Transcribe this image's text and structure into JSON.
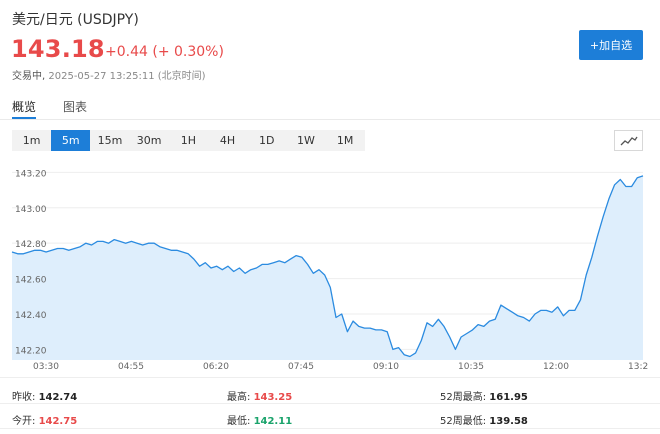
{
  "header": {
    "title": "美元/日元 (USDJPY)",
    "price": "143.18",
    "change": "+0.44 (+ 0.30%)",
    "status_label": "交易中,",
    "timestamp": "2025-05-27 13:25:11 (北京时间)",
    "watch_button": "+加自选"
  },
  "tabs": [
    {
      "label": "概览",
      "active": true
    },
    {
      "label": "图表",
      "active": false
    }
  ],
  "ranges": [
    {
      "label": "1m",
      "active": false
    },
    {
      "label": "5m",
      "active": true
    },
    {
      "label": "15m",
      "active": false
    },
    {
      "label": "30m",
      "active": false
    },
    {
      "label": "1H",
      "active": false
    },
    {
      "label": "4H",
      "active": false
    },
    {
      "label": "1D",
      "active": false
    },
    {
      "label": "1W",
      "active": false
    },
    {
      "label": "1M",
      "active": false
    }
  ],
  "chart_type_icon": "line-chart-icon",
  "colors": {
    "accent": "#1d7ed8",
    "up": "#e84a4a",
    "down": "#1aa36b",
    "line": "#2b8be0",
    "fill": "#deeefc"
  },
  "chart_data": {
    "type": "area",
    "xlabel": "",
    "ylabel": "",
    "ylim": [
      142.14,
      143.27
    ],
    "y_ticks": [
      "143.20",
      "143.00",
      "142.80",
      "142.60",
      "142.40",
      "142.20"
    ],
    "x_ticks": [
      "03:30",
      "04:55",
      "06:20",
      "07:45",
      "09:10",
      "10:35",
      "12:00",
      "13:2"
    ],
    "series": [
      {
        "values": [
          142.75,
          142.74,
          142.74,
          142.75,
          142.76,
          142.76,
          142.75,
          142.76,
          142.77,
          142.77,
          142.76,
          142.77,
          142.78,
          142.8,
          142.79,
          142.81,
          142.81,
          142.8,
          142.82,
          142.81,
          142.8,
          142.81,
          142.8,
          142.79,
          142.8,
          142.8,
          142.78,
          142.77,
          142.76,
          142.76,
          142.75,
          142.74,
          142.71,
          142.67,
          142.69,
          142.66,
          142.67,
          142.65,
          142.67,
          142.64,
          142.66,
          142.63,
          142.65,
          142.66,
          142.68,
          142.68,
          142.69,
          142.7,
          142.69,
          142.71,
          142.73,
          142.72,
          142.68,
          142.63,
          142.65,
          142.62,
          142.55,
          142.38,
          142.4,
          142.3,
          142.36,
          142.33,
          142.32,
          142.32,
          142.31,
          142.31,
          142.3,
          142.2,
          142.21,
          142.17,
          142.16,
          142.18,
          142.25,
          142.35,
          142.33,
          142.37,
          142.33,
          142.27,
          142.2,
          142.27,
          142.29,
          142.31,
          142.34,
          142.33,
          142.36,
          142.37,
          142.45,
          142.43,
          142.41,
          142.39,
          142.38,
          142.36,
          142.4,
          142.42,
          142.42,
          142.41,
          142.44,
          142.39,
          142.42,
          142.42,
          142.48,
          142.62,
          142.72,
          142.84,
          142.95,
          143.05,
          143.13,
          143.16,
          143.12,
          143.12,
          143.17,
          143.18
        ]
      }
    ]
  },
  "stats": [
    {
      "label": "昨收:",
      "value": "142.74",
      "color": "dark"
    },
    {
      "label": "最高:",
      "value": "143.25",
      "color": "red"
    },
    {
      "label": "52周最高:",
      "value": "161.95",
      "color": "dark"
    },
    {
      "label": "今开:",
      "value": "142.75",
      "color": "red"
    },
    {
      "label": "最低:",
      "value": "142.11",
      "color": "green"
    },
    {
      "label": "52周最低:",
      "value": "139.58",
      "color": "dark"
    }
  ]
}
